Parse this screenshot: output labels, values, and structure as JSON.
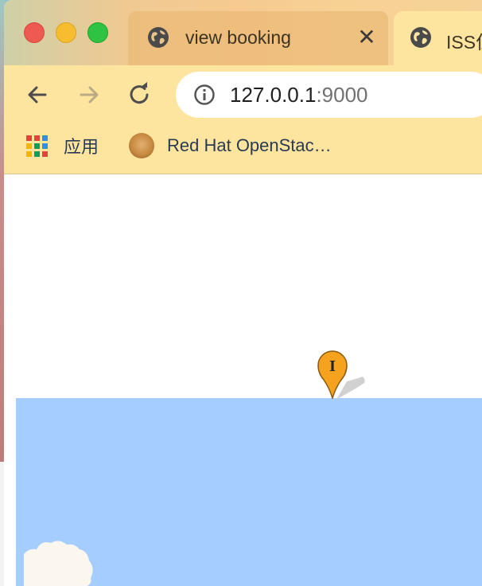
{
  "browser": {
    "tabs": [
      {
        "title": "view booking",
        "icon": "globe-icon",
        "active": false,
        "close": "✕"
      },
      {
        "title": "ISS位",
        "icon": "globe-icon",
        "active": true
      }
    ],
    "url": {
      "host": "127.0.0.1",
      "port": ":9000"
    },
    "bookmarks": [
      {
        "label": "应用",
        "icon": "apps-grid-icon"
      },
      {
        "label": "Red Hat OpenStac…",
        "icon": "dog-avatar-icon"
      }
    ]
  },
  "map": {
    "marker_label": "I",
    "ocean_color": "#a5cdfd",
    "land_color": "#fbf7ee",
    "marker_color": "#f5a21e"
  },
  "colors": {
    "toolbar": "#fde59f",
    "traffic_red": "#ee5a52",
    "traffic_yellow": "#f5bd2f",
    "traffic_green": "#2ec342"
  }
}
